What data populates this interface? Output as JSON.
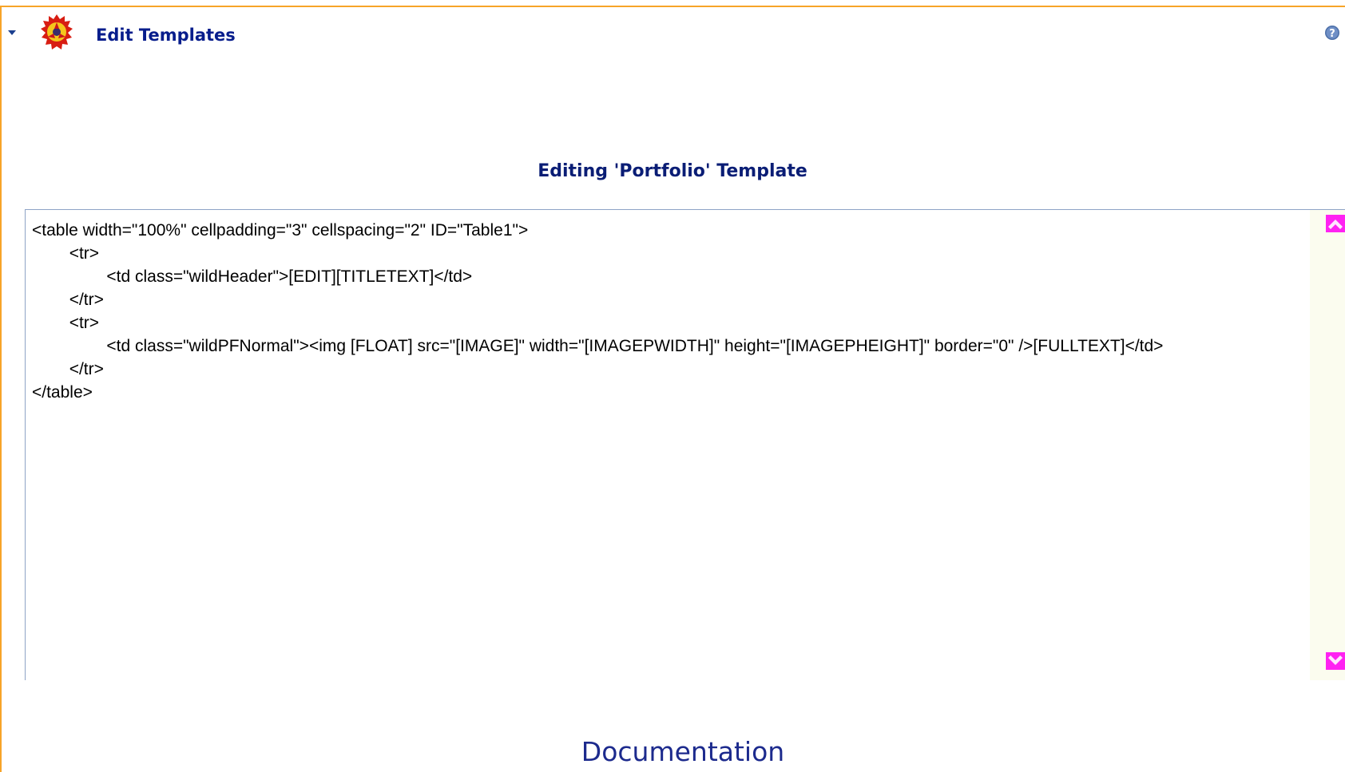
{
  "module": {
    "title": "Edit Templates",
    "collapse_icon": "triangle-down-icon",
    "module_icon": "gear-module-icon",
    "help_icon": "help-question-icon"
  },
  "editor": {
    "heading": "Editing 'Portfolio' Template",
    "content": "<table width=\"100%\" cellpadding=\"3\" cellspacing=\"2\" ID=\"Table1\">\n\t<tr>\n\t\t<td class=\"wildHeader\">[EDIT][TITLETEXT]</td>\n\t</tr>\n\t<tr>\n\t\t<td class=\"wildPFNormal\"><img [FLOAT] src=\"[IMAGE]\" width=\"[IMAGEPWIDTH]\" height=\"[IMAGEPHEIGHT]\" border=\"0\" />[FULLTEXT]</td>\n\t</tr>\n</table>",
    "scroll_up_icon": "chevron-up-icon",
    "scroll_down_icon": "chevron-down-icon"
  },
  "footer": {
    "documentation_label": "Documentation"
  },
  "colors": {
    "frame_border": "#f7a428",
    "title_text": "#071d8c",
    "editor_border": "#8ea3c6",
    "scroll_button": "#ff22f2"
  }
}
